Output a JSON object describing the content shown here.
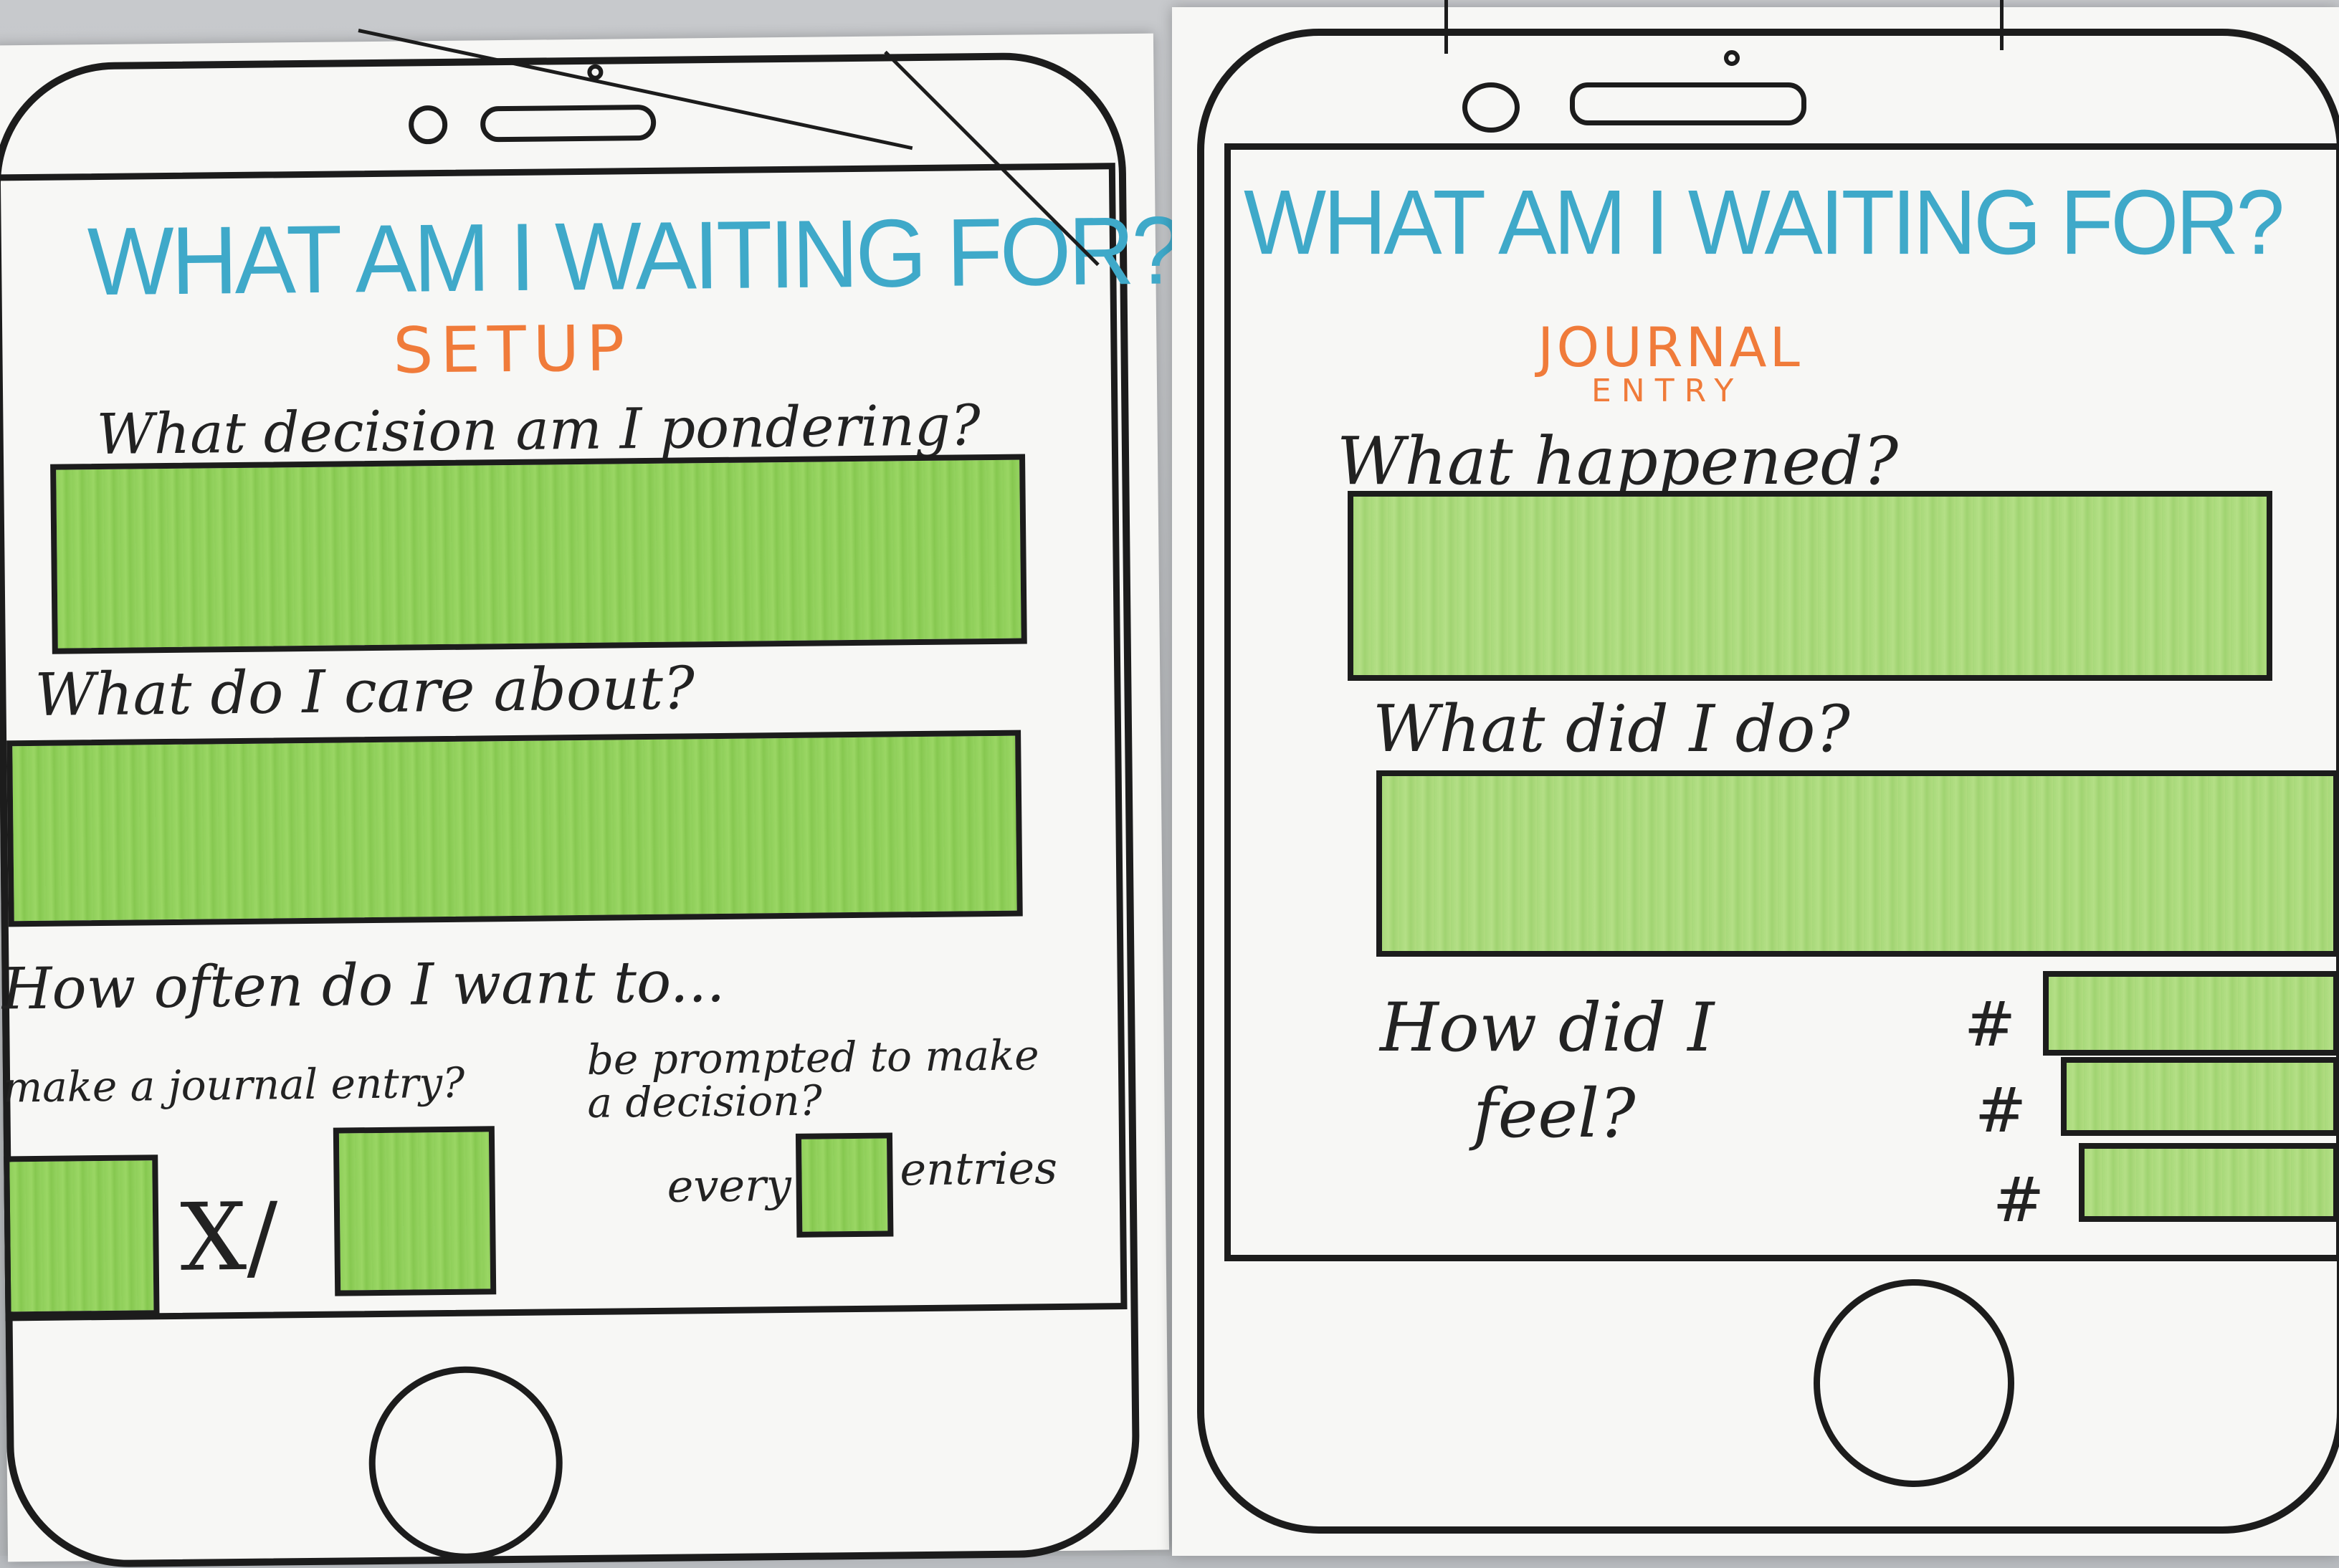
{
  "left_poster": {
    "title": "WHAT AM I WAITING FOR?",
    "subtitle": "SETUP",
    "question_1": "What decision am I pondering?",
    "question_2": "What do I care about?",
    "question_3": "How often do I want to...",
    "option_a": "make a journal entry?",
    "option_b_line1": "be prompted to make",
    "option_b_line2": "a decision?",
    "frequency_separator": "X/",
    "every_label": "every",
    "entries_label": "entries"
  },
  "right_poster": {
    "title": "WHAT AM I WAITING FOR?",
    "subtitle_line1": "JOURNAL",
    "subtitle_line2": "ENTRY",
    "question_1": "What happened?",
    "question_2": "What did I do?",
    "question_3_line1": "How did I",
    "question_3_line2": "feel?",
    "hash_1": "#",
    "hash_2": "#",
    "hash_3": "#"
  },
  "colors": {
    "title": "#3fa9c9",
    "subtitle": "#f07b3a",
    "field_fill": "#8fcf5a",
    "outline": "#1c1c1c"
  }
}
